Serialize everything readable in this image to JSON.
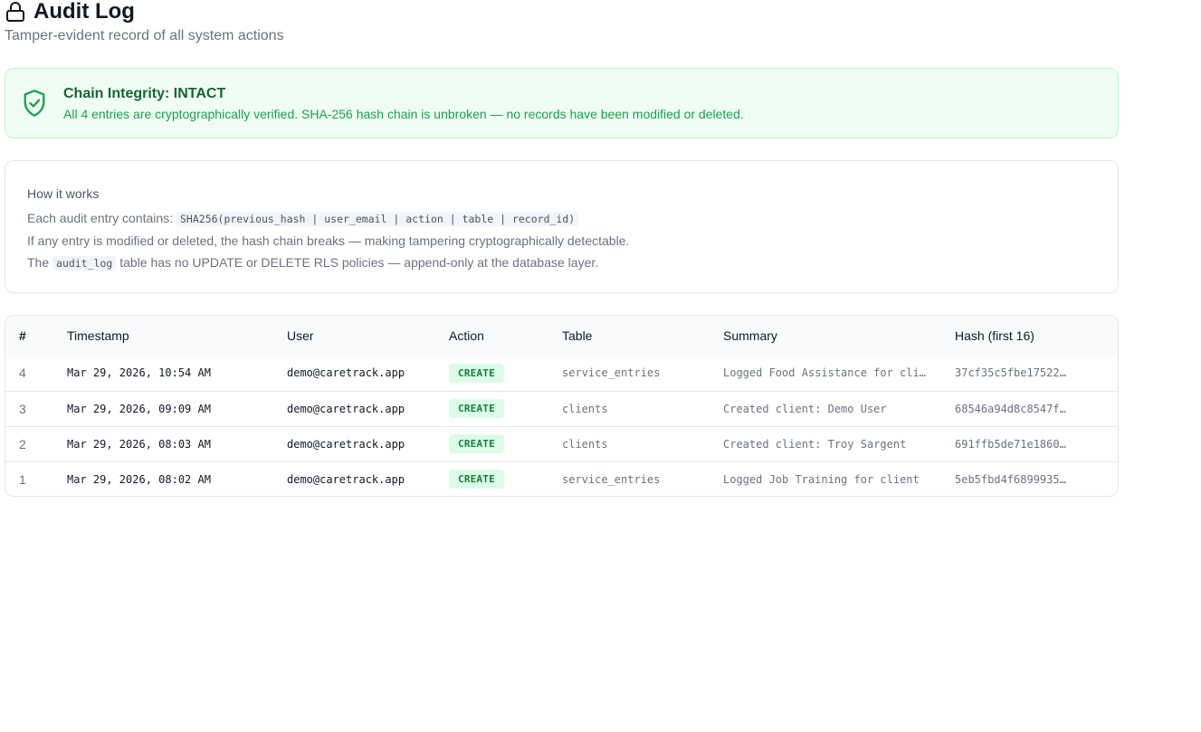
{
  "header": {
    "title": "Audit Log",
    "subtitle": "Tamper-evident record of all system actions",
    "icon": "lock-icon"
  },
  "integrity": {
    "icon": "shield-check-icon",
    "title": "Chain Integrity: INTACT",
    "message": "All 4 entries are cryptographically verified. SHA-256 hash chain is unbroken — no records have been modified or deleted.",
    "colors": {
      "background": "#f0fdf4",
      "border": "#bbf7d0",
      "title": "#166534",
      "text": "#16a34a"
    }
  },
  "how_it_works": {
    "title": "How it works",
    "line1_prefix": "Each audit entry contains: ",
    "line1_code": "SHA256(previous_hash | user_email | action | table | record_id)",
    "line2": "If any entry is modified or deleted, the hash chain breaks — making tampering cryptographically detectable.",
    "line3_prefix": "The ",
    "line3_code": "audit_log",
    "line3_suffix": " table has no UPDATE or DELETE RLS policies — append-only at the database layer."
  },
  "table": {
    "columns": [
      "#",
      "Timestamp",
      "User",
      "Action",
      "Table",
      "Summary",
      "Hash (first 16)"
    ],
    "rows": [
      {
        "num": "4",
        "timestamp": "Mar 29, 2026, 10:54 AM",
        "user": "demo@caretrack.app",
        "action": "CREATE",
        "table": "service_entries",
        "summary": "Logged Food Assistance for client",
        "hash": "37cf35c5fbe17522…"
      },
      {
        "num": "3",
        "timestamp": "Mar 29, 2026, 09:09 AM",
        "user": "demo@caretrack.app",
        "action": "CREATE",
        "table": "clients",
        "summary": "Created client: Demo User",
        "hash": "68546a94d8c8547f…"
      },
      {
        "num": "2",
        "timestamp": "Mar 29, 2026, 08:03 AM",
        "user": "demo@caretrack.app",
        "action": "CREATE",
        "table": "clients",
        "summary": "Created client: Troy Sargent",
        "hash": "691ffb5de71e1860…"
      },
      {
        "num": "1",
        "timestamp": "Mar 29, 2026, 08:02 AM",
        "user": "demo@caretrack.app",
        "action": "CREATE",
        "table": "service_entries",
        "summary": "Logged Job Training for client",
        "hash": "5eb5fbd4f6899935…"
      }
    ],
    "badge_colors": {
      "background": "#dcfce7",
      "text": "#15803d"
    }
  }
}
